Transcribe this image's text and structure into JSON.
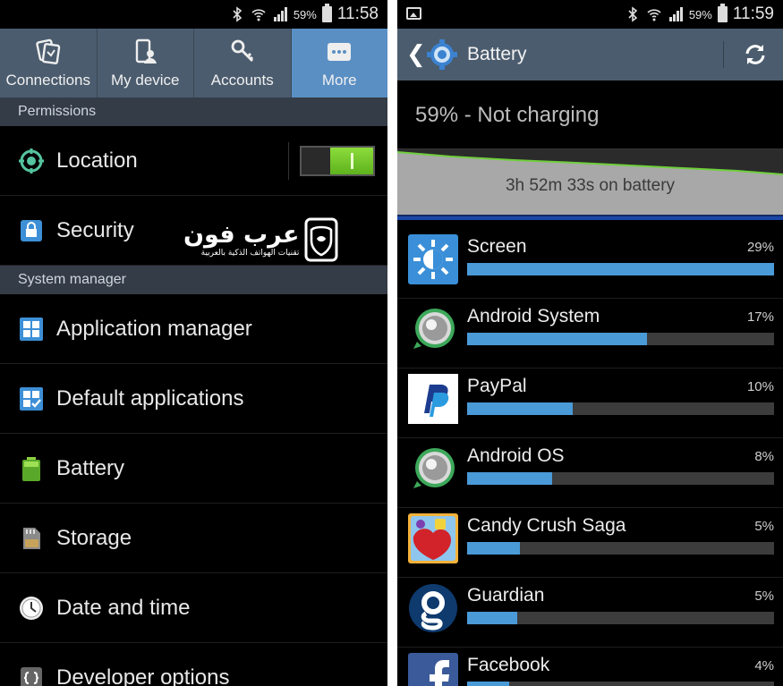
{
  "left": {
    "status": {
      "battery_pct": "59%",
      "time": "11:58"
    },
    "tabs": [
      {
        "label": "Connections",
        "icon": "connections-icon",
        "active": false
      },
      {
        "label": "My device",
        "icon": "my-device-icon",
        "active": false
      },
      {
        "label": "Accounts",
        "icon": "accounts-icon",
        "active": false
      },
      {
        "label": "More",
        "icon": "more-icon",
        "active": true
      }
    ],
    "sections": {
      "permissions": "Permissions",
      "system_manager": "System manager"
    },
    "permissions_items": [
      {
        "label": "Location",
        "icon": "location-icon",
        "toggle_on": true
      },
      {
        "label": "Security",
        "icon": "lock-icon"
      }
    ],
    "system_items": [
      {
        "label": "Application manager",
        "icon": "app-grid-icon"
      },
      {
        "label": "Default applications",
        "icon": "default-apps-icon"
      },
      {
        "label": "Battery",
        "icon": "battery-icon"
      },
      {
        "label": "Storage",
        "icon": "sd-card-icon"
      },
      {
        "label": "Date and time",
        "icon": "clock-icon"
      },
      {
        "label": "Developer options",
        "icon": "developer-icon"
      }
    ],
    "watermark": {
      "main": "عرب فون",
      "sub": "تقنيات الهواتف الذكية بالعربية"
    }
  },
  "right": {
    "status": {
      "battery_pct": "59%",
      "time": "11:59"
    },
    "header": {
      "title": "Battery"
    },
    "battery_status": "59% - Not charging",
    "graph_label": "3h 52m 33s on battery",
    "apps": [
      {
        "name": "Screen",
        "percent": "29%",
        "usage": 100,
        "icon": "screen-brightness-icon"
      },
      {
        "name": "Android System",
        "percent": "17%",
        "usage": 58.6,
        "icon": "android-system-icon"
      },
      {
        "name": "PayPal",
        "percent": "10%",
        "usage": 34.5,
        "icon": "paypal-icon"
      },
      {
        "name": "Android OS",
        "percent": "8%",
        "usage": 27.6,
        "icon": "android-os-icon"
      },
      {
        "name": "Candy Crush Saga",
        "percent": "5%",
        "usage": 17.2,
        "icon": "candy-crush-icon"
      },
      {
        "name": "Guardian",
        "percent": "5%",
        "usage": 16.4,
        "icon": "guardian-icon"
      },
      {
        "name": "Facebook",
        "percent": "4%",
        "usage": 13.8,
        "icon": "facebook-icon"
      }
    ]
  }
}
